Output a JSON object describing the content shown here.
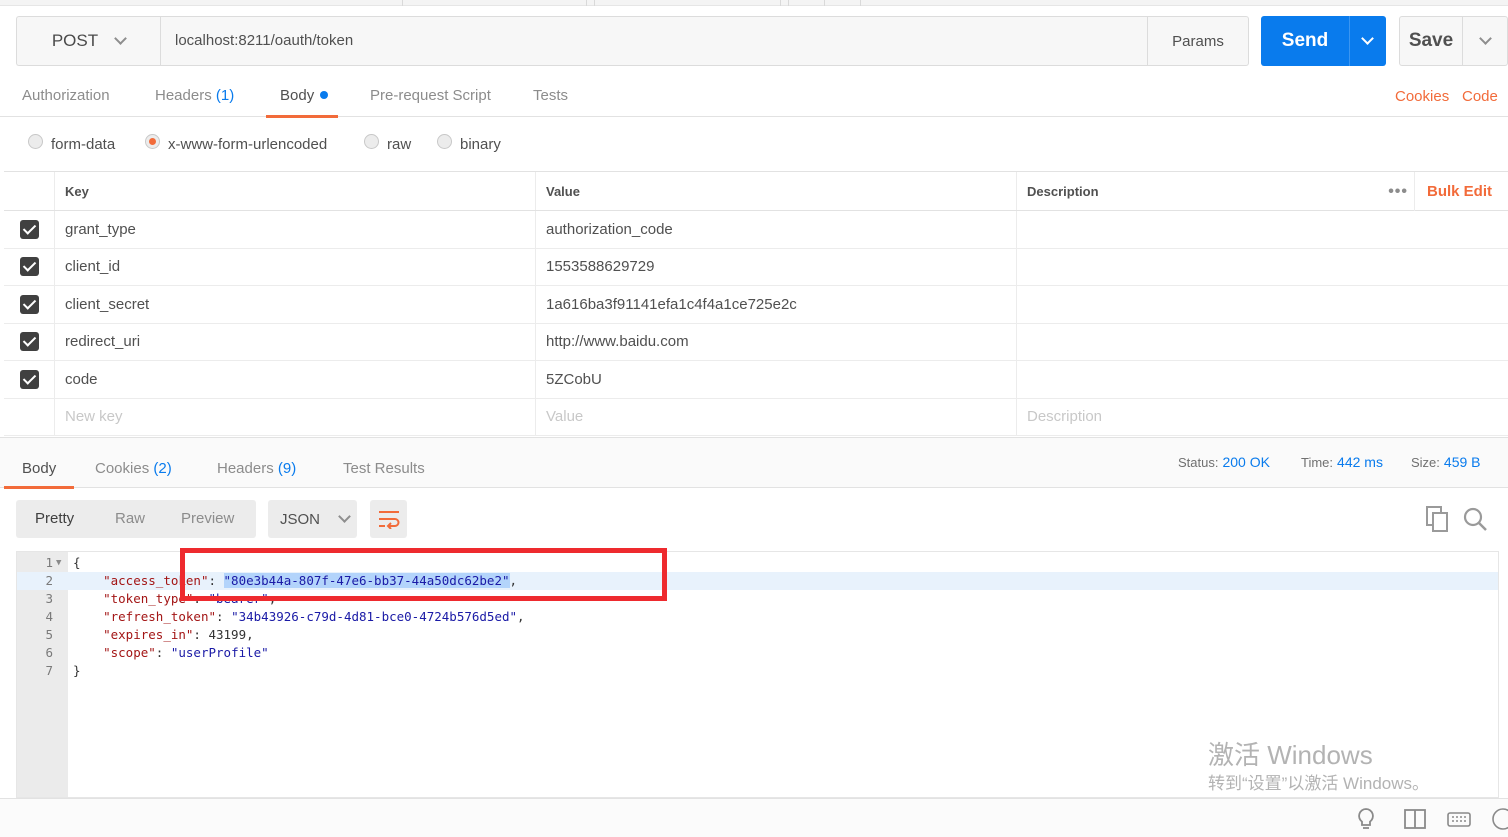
{
  "request": {
    "method": "POST",
    "url": "localhost:8211/oauth/token",
    "params_label": "Params",
    "send_label": "Send",
    "save_label": "Save"
  },
  "request_tabs": {
    "authorization": "Authorization",
    "headers": "Headers",
    "headers_count": "(1)",
    "body": "Body",
    "prerequest": "Pre-request Script",
    "tests": "Tests",
    "cookies": "Cookies",
    "code": "Code"
  },
  "body_types": {
    "form_data": "form-data",
    "urlencoded": "x-www-form-urlencoded",
    "raw": "raw",
    "binary": "binary",
    "selected": "x-www-form-urlencoded"
  },
  "kv_table": {
    "headers": {
      "key": "Key",
      "value": "Value",
      "description": "Description"
    },
    "more": "•••",
    "bulk_edit": "Bulk Edit",
    "rows": [
      {
        "key": "grant_type",
        "value": "authorization_code",
        "checked": true
      },
      {
        "key": "client_id",
        "value": "1553588629729",
        "checked": true
      },
      {
        "key": "client_secret",
        "value": "1a616ba3f91141efa1c4f4a1ce725e2c",
        "checked": true
      },
      {
        "key": "redirect_uri",
        "value": "http://www.baidu.com",
        "checked": true
      },
      {
        "key": "code",
        "value": "5ZCobU",
        "checked": true
      }
    ],
    "placeholders": {
      "key": "New key",
      "value": "Value",
      "description": "Description"
    }
  },
  "response_tabs": {
    "body": "Body",
    "cookies": "Cookies",
    "cookies_count": "(2)",
    "headers": "Headers",
    "headers_count": "(9)",
    "test_results": "Test Results"
  },
  "response_status": {
    "status_label": "Status:",
    "status_value": "200 OK",
    "time_label": "Time:",
    "time_value": "442 ms",
    "size_label": "Size:",
    "size_value": "459 B"
  },
  "response_format": {
    "pretty": "Pretty",
    "raw": "Raw",
    "preview": "Preview",
    "language": "JSON"
  },
  "response_body": {
    "open": "{",
    "close": "}",
    "fields": [
      {
        "key": "\"access_token\"",
        "value": "\"80e3b44a-807f-47e6-bb37-44a50dc62be2\""
      },
      {
        "key": "\"token_type\"",
        "value": "\"bearer\""
      },
      {
        "key": "\"refresh_token\"",
        "value": "\"34b43926-c79d-4d81-bce0-4724b576d5ed\""
      },
      {
        "key": "\"expires_in\"",
        "value": "43199"
      },
      {
        "key": "\"scope\"",
        "value": "\"userProfile\""
      }
    ],
    "line_numbers": [
      "1",
      "2",
      "3",
      "4",
      "5",
      "6",
      "7"
    ],
    "highlight_line": 2
  },
  "watermark": {
    "line1": "激活 Windows",
    "line2": "转到“设置”以激活 Windows。"
  },
  "colors": {
    "accent": "#f26b3a",
    "primary": "#097bed",
    "annotation": "#ee2a2e"
  }
}
